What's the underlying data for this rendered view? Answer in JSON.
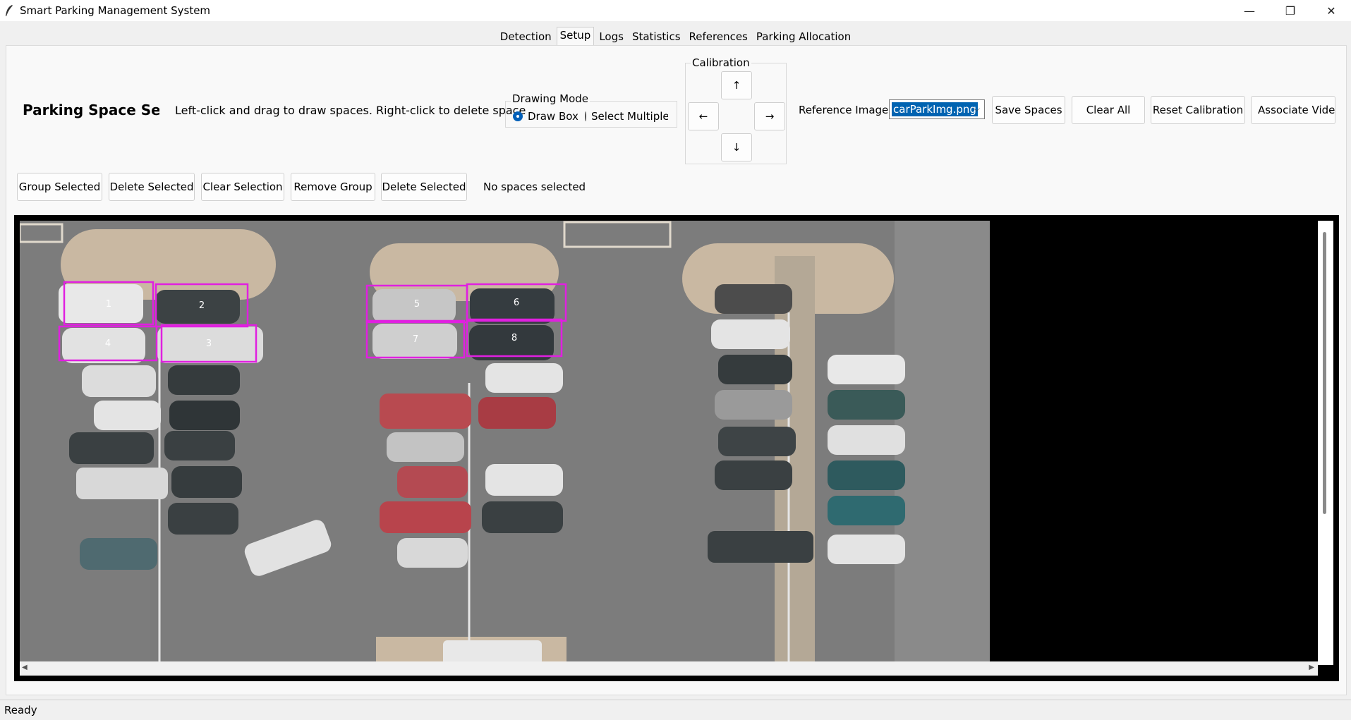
{
  "window": {
    "title": "Smart Parking Management System"
  },
  "tabs": [
    {
      "label": "Detection"
    },
    {
      "label": "Setup"
    },
    {
      "label": "Logs"
    },
    {
      "label": "Statistics"
    },
    {
      "label": "References"
    },
    {
      "label": "Parking Allocation"
    }
  ],
  "active_tab": "Setup",
  "setup": {
    "heading": "Parking Space Setup",
    "instructions": "Left-click and drag to draw spaces. Right-click to delete space",
    "drawing_mode": {
      "title": "Drawing Mode",
      "options": [
        "Draw Box",
        "Select Multiple"
      ],
      "selected": "Draw Box"
    },
    "calibration": {
      "title": "Calibration",
      "up": "↑",
      "down": "↓",
      "left": "←",
      "right": "→"
    },
    "reference_label": "Reference Image",
    "reference_value": "carParkImg.png",
    "buttons": {
      "save": "Save Spaces",
      "clear_all": "Clear All",
      "reset_cal": "Reset Calibration",
      "associate": "Associate Video"
    },
    "selection_buttons": {
      "group": "Group Selected",
      "delete1": "Delete Selected",
      "clear_sel": "Clear Selection",
      "remove_group": "Remove Group",
      "delete2": "Delete Selected"
    },
    "selection_status": "No spaces selected",
    "spaces": [
      "1",
      "2",
      "3",
      "4",
      "5",
      "6",
      "7",
      "8"
    ]
  },
  "colors": {
    "space_box": "#e020e0",
    "accent": "#0063b1"
  },
  "status": "Ready"
}
